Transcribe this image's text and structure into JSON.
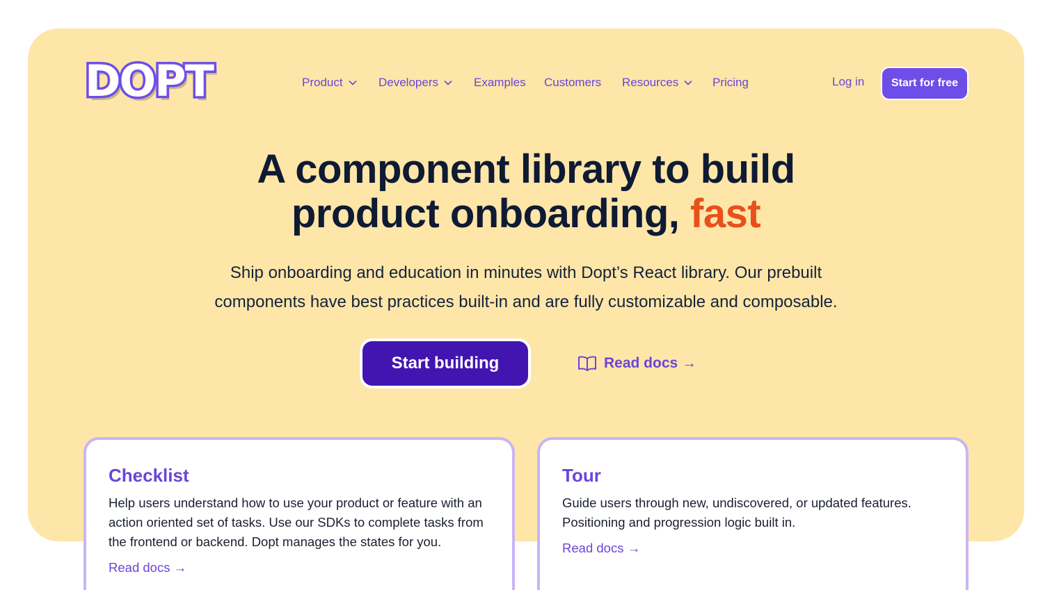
{
  "brand": {
    "logo_text": "DOPT",
    "primary": "#6d4ee8",
    "dark_button": "#4215b0",
    "hero_bg": "#fee6a9",
    "accent": "#e8501b"
  },
  "nav": {
    "items": [
      {
        "label": "Product",
        "has_dropdown": true
      },
      {
        "label": "Developers",
        "has_dropdown": true
      },
      {
        "label": "Examples",
        "has_dropdown": false
      },
      {
        "label": "Customers",
        "has_dropdown": false
      },
      {
        "label": "Resources",
        "has_dropdown": true
      },
      {
        "label": "Pricing",
        "has_dropdown": false
      }
    ],
    "login": "Log in",
    "cta": "Start for free"
  },
  "hero": {
    "headline_line1": "A component library to build",
    "headline_line2": "product onboarding,",
    "headline_accent": "fast",
    "subtitle_line1": "Ship onboarding and education in minutes with Dopt’s React library. Our prebuilt",
    "subtitle_line2": "components have best practices built-in and are fully customizable and composable.",
    "primary_cta": "Start building",
    "secondary_cta": "Read docs →",
    "secondary_icon": "book-open-icon"
  },
  "cards": [
    {
      "title": "Checklist",
      "description": "Help users understand how to use your product or feature with an action oriented set of tasks. Use our SDKs to complete tasks from the frontend or backend. Dopt manages the states for you.",
      "link": "Read docs →"
    },
    {
      "title": "Tour",
      "description": "Guide users through new, undiscovered, or updated features. Positioning and progression logic built in.",
      "link": "Read docs →"
    }
  ]
}
